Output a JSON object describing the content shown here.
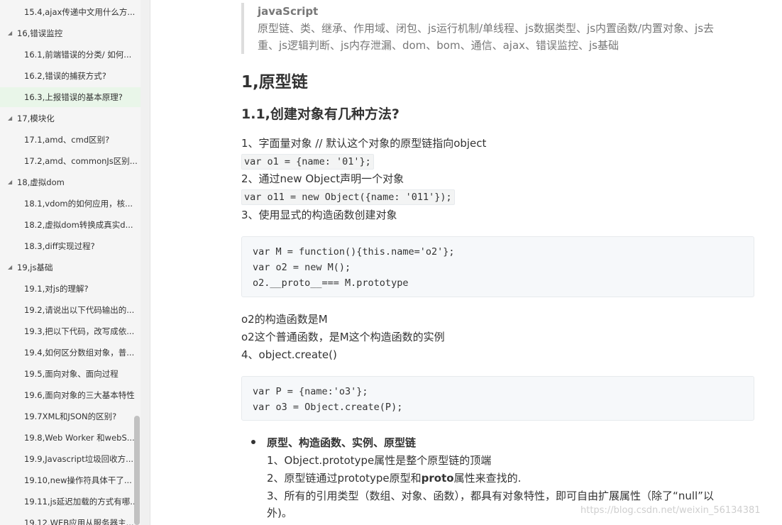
{
  "sidebar": {
    "items": [
      {
        "label": "15.4,ajax传递中文用什么方...",
        "level": 2
      },
      {
        "label": "16,错误监控",
        "level": 1,
        "expanded": true
      },
      {
        "label": "16.1,前端错误的分类/ 如何...",
        "level": 2
      },
      {
        "label": "16.2,错误的捕获方式?",
        "level": 2
      },
      {
        "label": "16.3,上报错误的基本原理?",
        "level": 2,
        "active": true
      },
      {
        "label": "17,模块化",
        "level": 1,
        "expanded": true
      },
      {
        "label": "17.1,amd、cmd区别?",
        "level": 2
      },
      {
        "label": "17.2,amd、commonJs区别...",
        "level": 2
      },
      {
        "label": "18,虚拟dom",
        "level": 1,
        "expanded": true
      },
      {
        "label": "18.1,vdom的如何应用，核...",
        "level": 2
      },
      {
        "label": "18.2,虚拟dom转换成真实d...",
        "level": 2
      },
      {
        "label": "18.3,diff实现过程?",
        "level": 2
      },
      {
        "label": "19,js基础",
        "level": 1,
        "expanded": true
      },
      {
        "label": "19.1,对js的理解?",
        "level": 2
      },
      {
        "label": "19.2,请说出以下代码输出的...",
        "level": 2
      },
      {
        "label": "19.3,把以下代码，改写成依...",
        "level": 2
      },
      {
        "label": "19.4,如何区分数组对象，普...",
        "level": 2
      },
      {
        "label": "19.5,面向对象、面向过程",
        "level": 2
      },
      {
        "label": "19.6,面向对象的三大基本特性",
        "level": 2
      },
      {
        "label": "19.7XML和JSON的区别?",
        "level": 2
      },
      {
        "label": "19.8,Web Worker 和webS...",
        "level": 2
      },
      {
        "label": "19.9,Javascript垃圾回收方...",
        "level": 2
      },
      {
        "label": "19.10,new操作符具体干了...",
        "level": 2
      },
      {
        "label": "19.11,js延迟加载的方式有哪...",
        "level": 2
      },
      {
        "label": "19.12,WEB应用从服务器主...",
        "level": 2
      }
    ],
    "caret_icon": "▲",
    "active_color": "#e9f6e9"
  },
  "content": {
    "quote_title": "javaScript",
    "quote_line1": "原型链、类、继承、作用域、闭包、js运行机制/单线程、js数据类型、js内置函数/内置对象、js去",
    "quote_line2": "重、js逻辑判断、js内存泄漏、dom、bom、通信、ajax、错误监控、js基础",
    "h1": "1,原型链",
    "h2": "1.1,创建对象有几种方法?",
    "p1": "1、字面量对象 // 默认这个对象的原型链指向object",
    "code1": "var o1 = {name: '01'};",
    "p2": "2、通过new Object声明一个对象",
    "code2": "var o11 = new Object({name: '011'});",
    "p3": "3、使用显式的构造函数创建对象",
    "block1": [
      "var M = function(){this.name='o2'};",
      "var o2 = new M();",
      "o2.__proto__=== M.prototype"
    ],
    "p4": "o2的构造函数是M",
    "p5": "o2这个普通函数，是M这个构造函数的实例",
    "p6": "4、object.create()",
    "block2": [
      "var P = {name:'o3'};",
      "var o3 = Object.create(P);"
    ],
    "bullet_head": "原型、构造函数、实例、原型链",
    "list1": "1、Object.prototype属性是整个原型链的顶端",
    "list2_pre": "2、原型链通过prototype原型和",
    "list2_bold": "proto",
    "list2_post": "属性来查找的.",
    "list3": "3、所有的引用类型（数组、对象、函数），都具有对象特性，即可自由扩展属性（除了“null”以",
    "list3b": "外)。"
  },
  "watermark": "https://blog.csdn.net/weixin_56134381"
}
